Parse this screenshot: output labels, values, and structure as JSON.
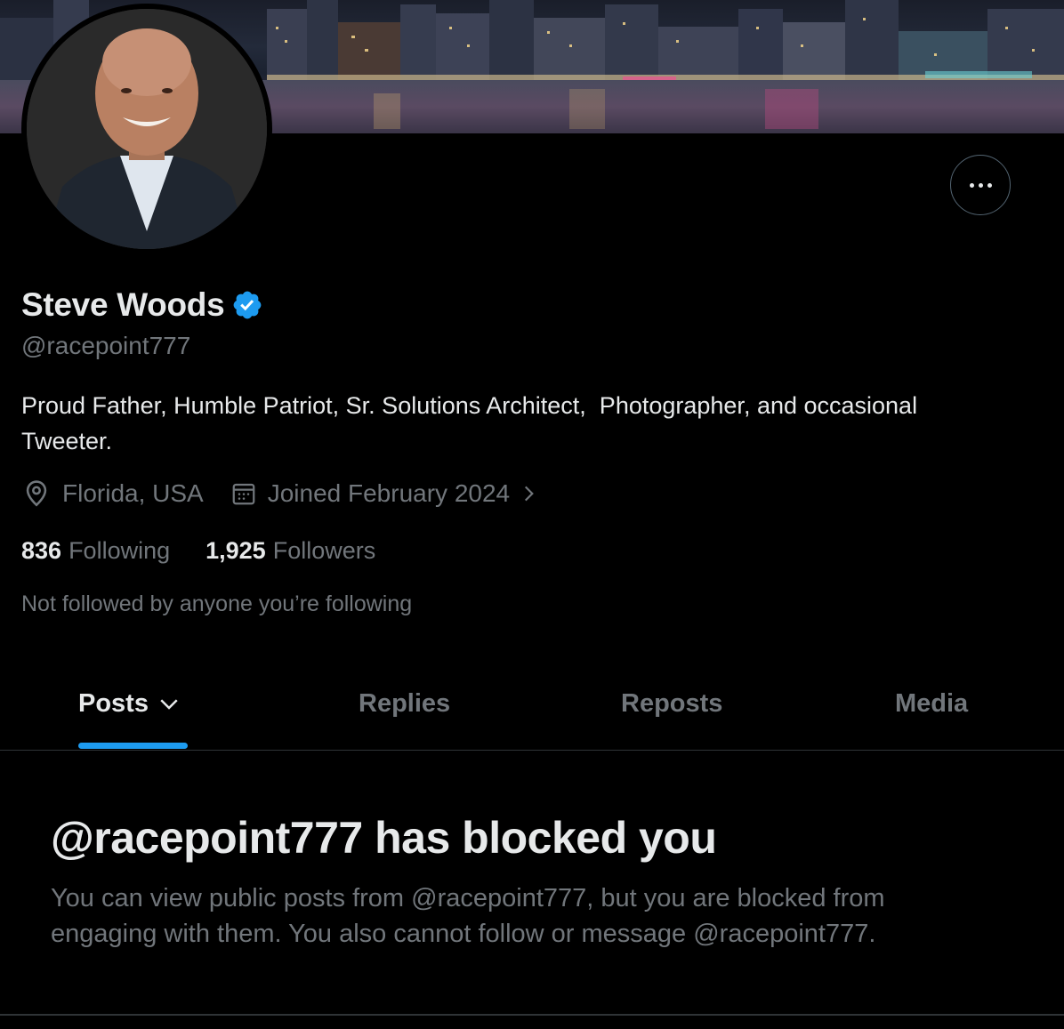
{
  "profile": {
    "display_name": "Steve Woods",
    "handle": "@racepoint777",
    "bio": "Proud Father, Humble Patriot, Sr. Solutions Architect,  Photographer, and occasional Tweeter.",
    "location": "Florida, USA",
    "joined": "Joined February 2024",
    "following_count": "836",
    "following_label": "Following",
    "followers_count": "1,925",
    "followers_label": "Followers",
    "not_followed_text": "Not followed by anyone you’re following"
  },
  "icons": {
    "verified": "verified-badge-icon",
    "location": "location-pin-icon",
    "calendar": "calendar-icon",
    "chevron": "chevron-right-icon",
    "more": "more-horizontal-icon",
    "tab_dropdown": "chevron-down-icon"
  },
  "tabs": [
    {
      "label": "Posts",
      "active": true
    },
    {
      "label": "Replies",
      "active": false
    },
    {
      "label": "Reposts",
      "active": false
    },
    {
      "label": "Media",
      "active": false
    }
  ],
  "blocked": {
    "title": "@racepoint777 has blocked you",
    "description": "You can view public posts from @racepoint777, but you are blocked from engaging with them. You also cannot follow or message @racepoint777."
  },
  "colors": {
    "background": "#000000",
    "text_primary": "#e7e9ea",
    "text_secondary": "#71767b",
    "accent": "#1d9bf0",
    "border": "#2f3336"
  }
}
